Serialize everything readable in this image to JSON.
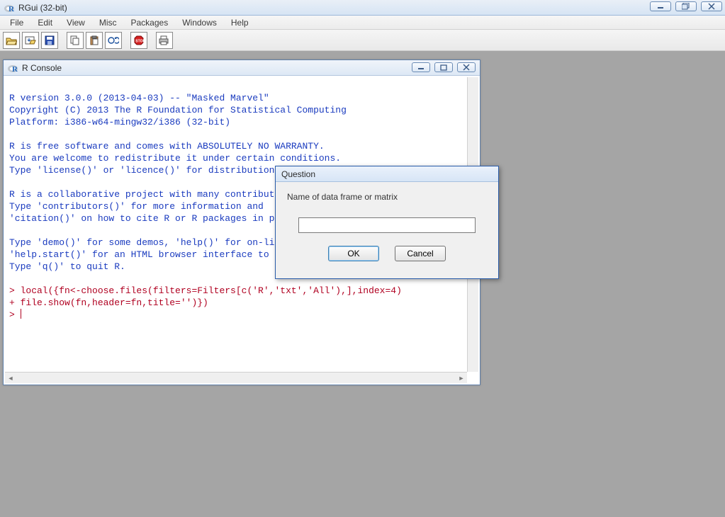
{
  "app": {
    "title": "RGui (32-bit)"
  },
  "menu": {
    "file": "File",
    "edit": "Edit",
    "view": "View",
    "misc": "Misc",
    "packages": "Packages",
    "windows": "Windows",
    "help": "Help"
  },
  "toolbar": {
    "icons": [
      "open",
      "load-ws",
      "save",
      "copy",
      "paste",
      "copy-paste",
      "stop",
      "print"
    ]
  },
  "console": {
    "title": "R Console",
    "text_black": "",
    "lines": [
      "",
      "R version 3.0.0 (2013-04-03) -- \"Masked Marvel\"",
      "Copyright (C) 2013 The R Foundation for Statistical Computing",
      "Platform: i386-w64-mingw32/i386 (32-bit)",
      "",
      "R is free software and comes with ABSOLUTELY NO WARRANTY.",
      "You are welcome to redistribute it under certain conditions.",
      "Type 'license()' or 'licence()' for distribution details.",
      "",
      "R is a collaborative project with many contributors.",
      "Type 'contributors()' for more information and",
      "'citation()' on how to cite R or R packages in publications.",
      "",
      "Type 'demo()' for some demos, 'help()' for on-line help, or",
      "'help.start()' for an HTML browser interface to help.",
      "Type 'q()' to quit R.",
      ""
    ],
    "red_lines": [
      "> local({fn<-choose.files(filters=Filters[c('R','txt','All'),],index=4)",
      "+ file.show(fn,header=fn,title='')})",
      "> "
    ]
  },
  "dialog": {
    "title": "Question",
    "label": "Name of data frame or matrix",
    "value": "",
    "ok": "OK",
    "cancel": "Cancel"
  }
}
